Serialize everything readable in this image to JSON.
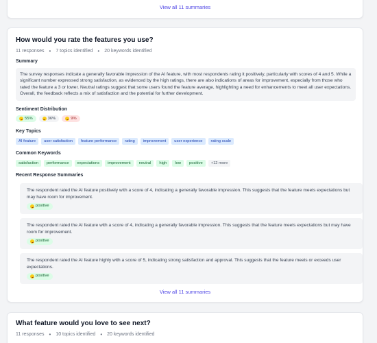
{
  "top_card": {
    "view_all_label": "View all 11 summaries"
  },
  "main_card": {
    "title": "How would you rate the features you use?",
    "responses": "11 responses",
    "topics": "7 topics identified",
    "keywords": "20 keywords identified",
    "summary_label": "Summary",
    "summary_text": "The survey responses indicate a generally favorable impression of the AI feature, with most respondents rating it positively, particularly with scores of 4 and 5. While a significant number expressed strong satisfaction, as evidenced by the high ratings, there are also indications of areas for improvement, especially from those who rated the feature a 3 or lower. Neutral ratings suggest that some users found the feature average, highlighting a need for enhancements to meet all user expectations. Overall, the feedback reflects a mix of satisfaction and the potential for further development.",
    "sentiment_label": "Sentiment Distribution",
    "sentiment": {
      "positive": "55%",
      "neutral": "36%",
      "negative": "9%"
    },
    "key_topics_label": "Key Topics",
    "key_topics": [
      "AI feature",
      "user satisfaction",
      "feature performance",
      "rating",
      "improvement",
      "user experience",
      "rating scale"
    ],
    "keywords_label": "Common Keywords",
    "common_keywords": [
      "satisfaction",
      "performance",
      "expectations",
      "improvement",
      "neutral",
      "high",
      "low",
      "positive"
    ],
    "keywords_more": "+12 more",
    "recent_label": "Recent Response Summaries",
    "recent": [
      {
        "text": "The respondent rated the AI feature positively with a score of 4, indicating a generally favorable impression. This suggests that the feature meets expectations but may have room for improvement.",
        "sentiment": "positive"
      },
      {
        "text": "The respondent rated the AI feature with a score of 4, indicating a generally favorable impression. This suggests that the feature meets expectations but may have room for improvement.",
        "sentiment": "positive"
      },
      {
        "text": "The respondent rated the AI feature highly with a score of 5, indicating strong satisfaction and approval. This suggests that the feature meets or exceeds user expectations.",
        "sentiment": "positive"
      }
    ],
    "view_all_label": "View all 11 summaries"
  },
  "bottom_card": {
    "title": "What feature would you love to see next?",
    "responses": "11 responses",
    "topics": "10 topics identified",
    "keywords": "20 keywords identified"
  },
  "colors": {
    "accent": "#4f46e5",
    "positive_bg": "#dcfce7",
    "negative_bg": "#fee2e2",
    "topic_bg": "#dbeafe"
  }
}
